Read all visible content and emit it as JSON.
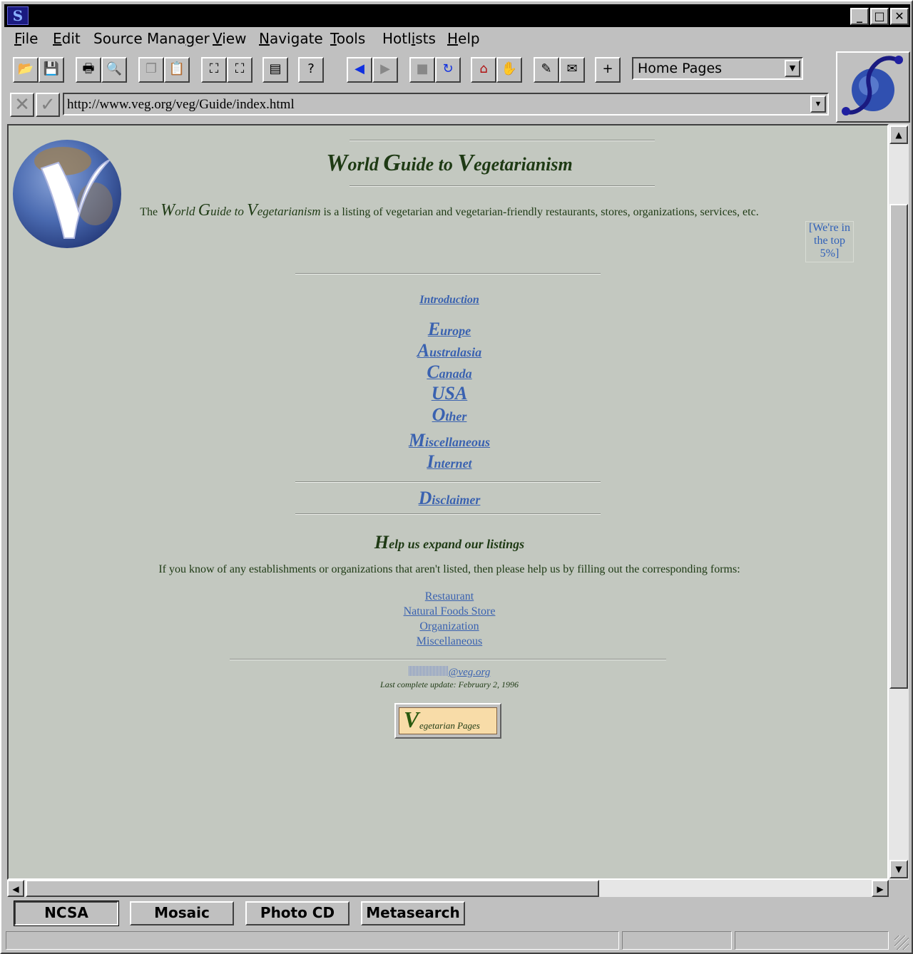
{
  "window": {
    "app_icon_glyph": "S"
  },
  "menu": [
    {
      "label_u": "F",
      "label_rest": "ile"
    },
    {
      "label_u": "E",
      "label_rest": "dit"
    },
    {
      "label_pre": "Source Mana",
      "label_u": "g",
      "label_rest": "er"
    },
    {
      "label_u": "V",
      "label_rest": "iew"
    },
    {
      "label_u": "N",
      "label_rest": "avigate"
    },
    {
      "label_u": "T",
      "label_rest": "ools"
    },
    {
      "label_pre": "Hotl",
      "label_u": "i",
      "label_rest": "sts"
    },
    {
      "label_u": "H",
      "label_rest": "elp"
    }
  ],
  "toolbar": {
    "icons": [
      "open-folder-icon",
      "save-disk-icon",
      "print-icon",
      "print-preview-icon",
      "copy-icon",
      "paste-icon",
      "find-binoculars-icon",
      "find-next-icon",
      "document-source-icon",
      "help-question-icon",
      "back-arrow-icon",
      "forward-arrow-icon",
      "stop-icon",
      "reload-icon",
      "home-icon",
      "hand-icon",
      "hotlist-icon",
      "mail-icon",
      "add-bookmark-icon"
    ],
    "home_pages_label": "Home Pages"
  },
  "address": {
    "url": "http://www.veg.org/veg/Guide/index.html"
  },
  "page": {
    "title_w": "W",
    "title_w_rest": "orld ",
    "title_g": "G",
    "title_g_rest": "uide to ",
    "title_v": "V",
    "title_v_rest": "egetarianism",
    "intro_prefix": "The ",
    "intro_suffix": " is a listing of vegetarian and vegetarian-friendly restaurants, stores, organizations, services, etc.",
    "top5_alt": "[We're in the top 5%]",
    "introduction": "Introduction",
    "regions": [
      {
        "big": "E",
        "rest": "urope"
      },
      {
        "big": "A",
        "rest": "ustralasia"
      },
      {
        "big": "C",
        "rest": "anada"
      },
      {
        "big": "USA",
        "rest": ""
      },
      {
        "big": "O",
        "rest": "ther"
      }
    ],
    "misc": [
      {
        "big": "M",
        "rest": "iscellaneous"
      },
      {
        "big": "I",
        "rest": "nternet"
      }
    ],
    "disclaimer": {
      "big": "D",
      "rest": "isclaimer"
    },
    "help_big": "H",
    "help_rest": "elp us expand our listings",
    "help_text": "If you know of any establishments or organizations that aren't listed, then please help us by filling out the corresponding forms:",
    "forms": [
      "Restaurant",
      "Natural Foods Store",
      "Organization",
      "Miscellaneous"
    ],
    "email_domain": "@veg.org",
    "last_update": "Last complete update: February 2, 1996",
    "veg_pages_big": "V",
    "veg_pages_rest": "egetarian Pages"
  },
  "hotlists": [
    "NCSA",
    "Mosaic",
    "Photo CD",
    "Metasearch"
  ]
}
